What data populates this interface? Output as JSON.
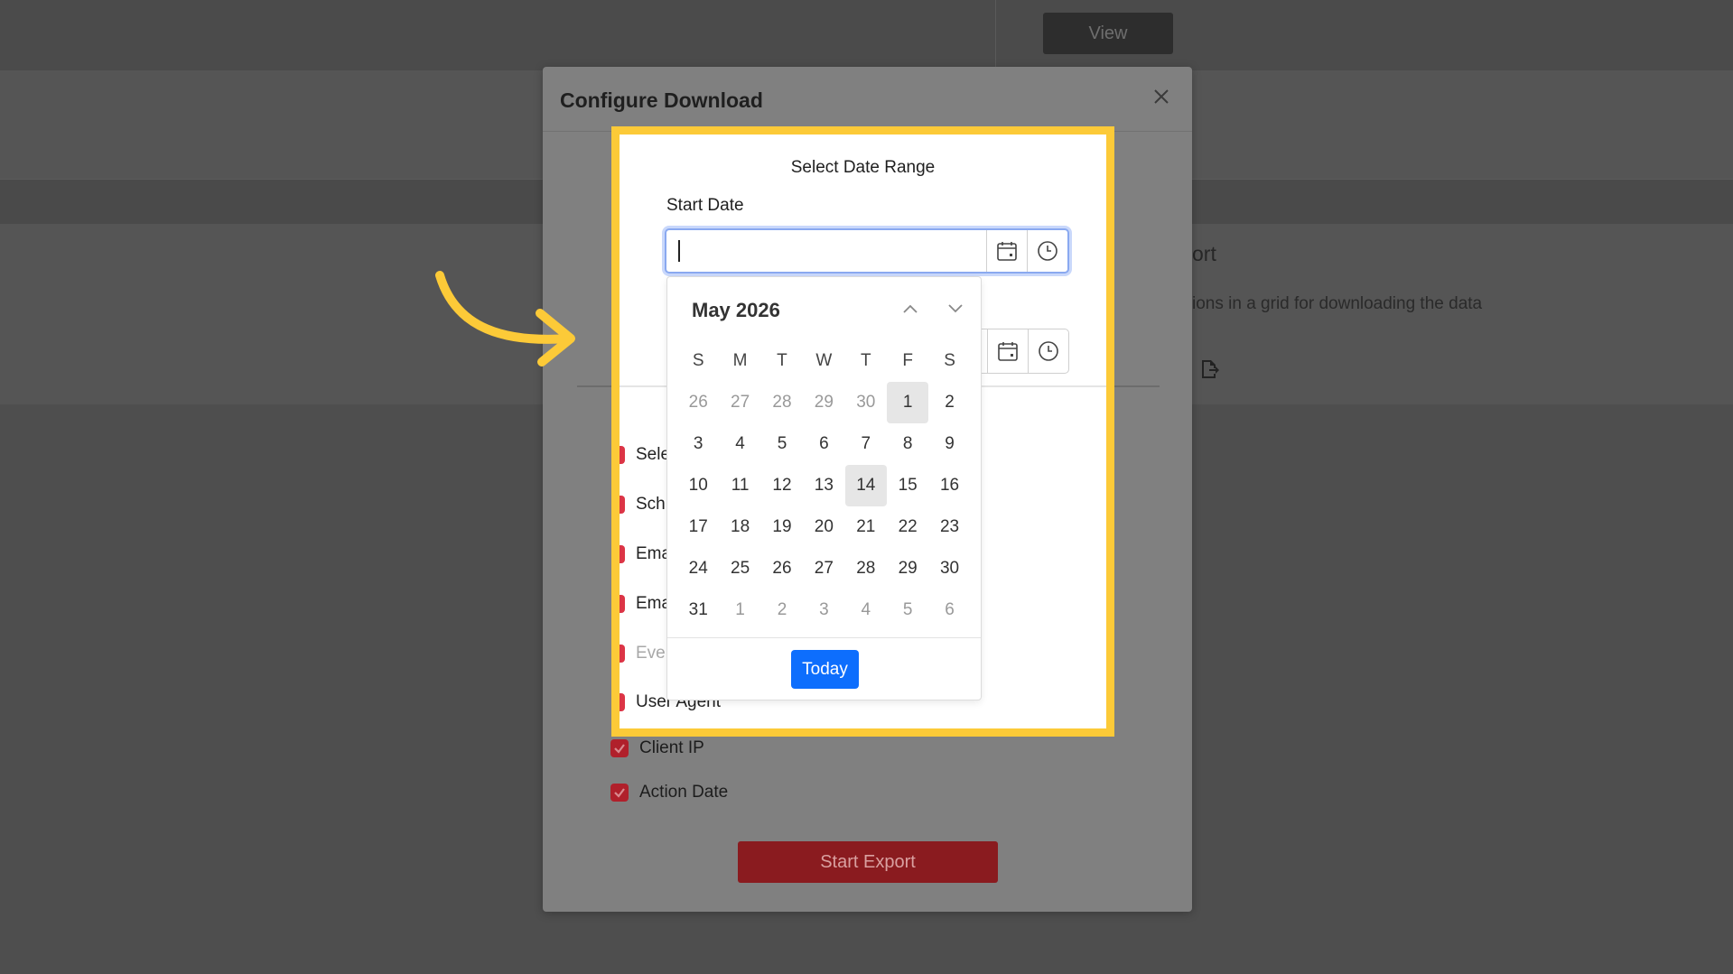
{
  "background": {
    "view_button": "View",
    "section_title": "ort",
    "section_desc": "ions in a grid for downloading the data"
  },
  "modal": {
    "title": "Configure Download",
    "columns": [
      "Client IP",
      "Action Date"
    ],
    "start_export": "Start Export"
  },
  "date_range": {
    "title": "Select Date Range",
    "start_label": "Start Date",
    "start_value": "",
    "partial_columns": [
      "Sele",
      "Sch",
      "Ema",
      "Ema",
      "Eve",
      "User Agent"
    ]
  },
  "calendar": {
    "month_label": "May 2026",
    "weekdays": [
      "S",
      "M",
      "T",
      "W",
      "T",
      "F",
      "S"
    ],
    "weeks": [
      [
        {
          "d": "26",
          "m": true
        },
        {
          "d": "27",
          "m": true
        },
        {
          "d": "28",
          "m": true
        },
        {
          "d": "29",
          "m": true
        },
        {
          "d": "30",
          "m": true
        },
        {
          "d": "1",
          "s": true
        },
        {
          "d": "2"
        }
      ],
      [
        {
          "d": "3"
        },
        {
          "d": "4"
        },
        {
          "d": "5"
        },
        {
          "d": "6"
        },
        {
          "d": "7"
        },
        {
          "d": "8"
        },
        {
          "d": "9"
        }
      ],
      [
        {
          "d": "10"
        },
        {
          "d": "11"
        },
        {
          "d": "12"
        },
        {
          "d": "13"
        },
        {
          "d": "14",
          "s": true
        },
        {
          "d": "15"
        },
        {
          "d": "16"
        }
      ],
      [
        {
          "d": "17"
        },
        {
          "d": "18"
        },
        {
          "d": "19"
        },
        {
          "d": "20"
        },
        {
          "d": "21"
        },
        {
          "d": "22"
        },
        {
          "d": "23"
        }
      ],
      [
        {
          "d": "24"
        },
        {
          "d": "25"
        },
        {
          "d": "26"
        },
        {
          "d": "27"
        },
        {
          "d": "28"
        },
        {
          "d": "29"
        },
        {
          "d": "30"
        }
      ],
      [
        {
          "d": "31"
        },
        {
          "d": "1",
          "m": true
        },
        {
          "d": "2",
          "m": true
        },
        {
          "d": "3",
          "m": true
        },
        {
          "d": "4",
          "m": true
        },
        {
          "d": "5",
          "m": true
        },
        {
          "d": "6",
          "m": true
        }
      ]
    ],
    "today_button": "Today"
  },
  "colors": {
    "highlight": "#fcca38",
    "accent": "#0d6efd",
    "checkbox": "#dc3545",
    "export": "#8a1b1f"
  }
}
